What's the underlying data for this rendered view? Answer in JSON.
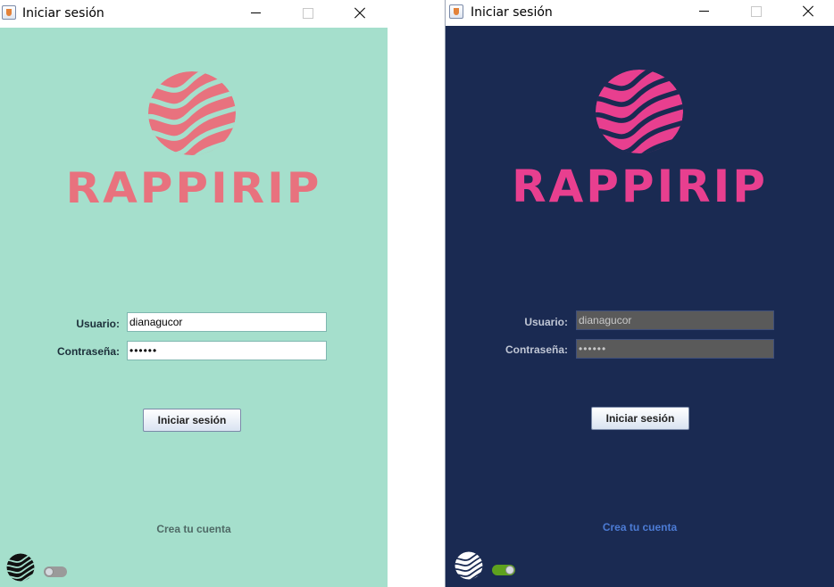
{
  "windows": [
    {
      "theme": "light",
      "title": "Iniciar sesión",
      "brand": "RAPPIRIP",
      "form": {
        "user_label": "Usuario:",
        "user_value": "dianagucor",
        "password_label": "Contraseña:",
        "password_value": "••••••"
      },
      "login_button": "Iniciar sesión",
      "create_account_link": "Crea tu cuenta",
      "dark_mode_toggle": false,
      "colors": {
        "background": "#a5dfcc",
        "brand": "#e8727e"
      }
    },
    {
      "theme": "dark",
      "title": "Iniciar sesión",
      "brand": "RAPPIRIP",
      "form": {
        "user_label": "Usuario:",
        "user_value": "dianagucor",
        "password_label": "Contraseña:",
        "password_value": "••••••"
      },
      "login_button": "Iniciar sesión",
      "create_account_link": "Crea tu cuenta",
      "dark_mode_toggle": true,
      "colors": {
        "background": "#1a2a52",
        "brand": "#e83f8f"
      }
    }
  ]
}
